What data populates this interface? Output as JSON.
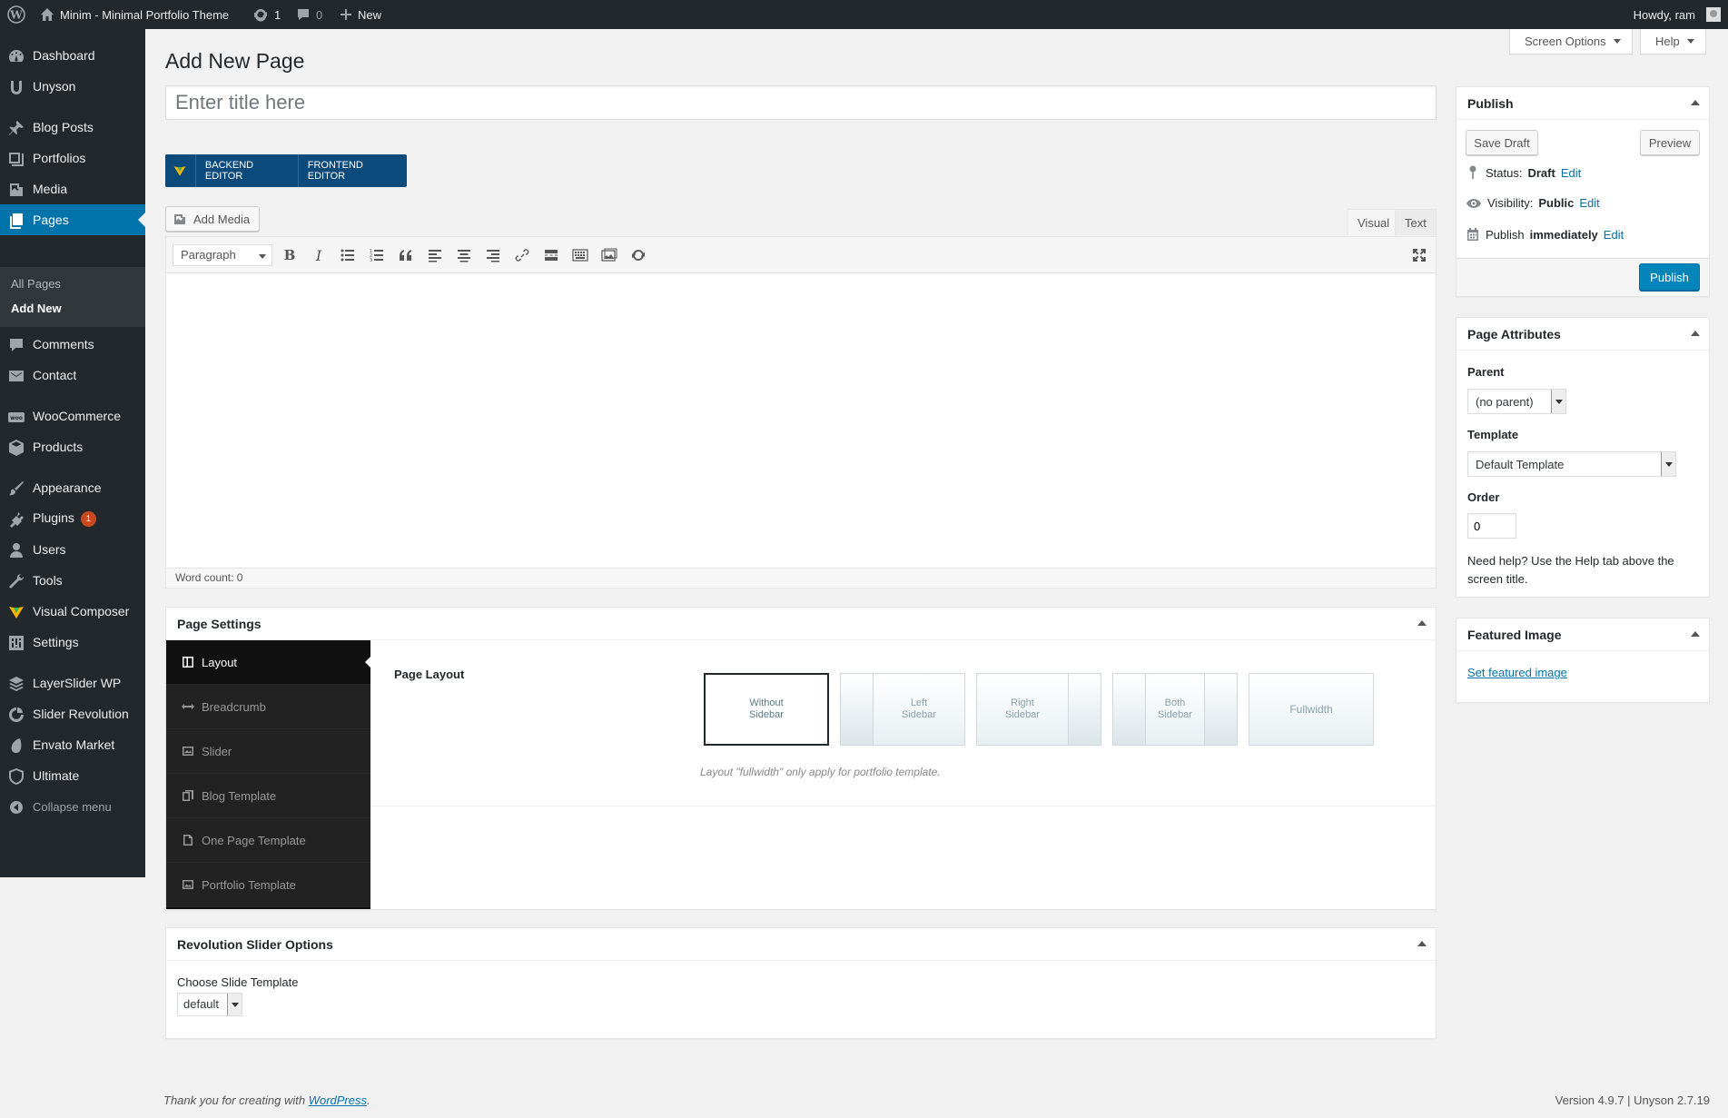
{
  "adminbar": {
    "site_name": "Minim - Minimal Portfolio Theme",
    "updates_count": "1",
    "comments_count": "0",
    "new_label": "New",
    "howdy": "Howdy, ram"
  },
  "sidebar": {
    "items": [
      {
        "label": "Dashboard",
        "icon": "dashboard-icon"
      },
      {
        "label": "Unyson",
        "icon": "unyson-icon"
      },
      {
        "label": "Blog Posts",
        "icon": "pin-icon"
      },
      {
        "label": "Portfolios",
        "icon": "portfolio-icon"
      },
      {
        "label": "Media",
        "icon": "media-icon"
      },
      {
        "label": "Pages",
        "icon": "pages-icon"
      },
      {
        "label": "Comments",
        "icon": "comments-icon"
      },
      {
        "label": "Contact",
        "icon": "mail-icon"
      },
      {
        "label": "WooCommerce",
        "icon": "woocommerce-icon"
      },
      {
        "label": "Products",
        "icon": "products-icon"
      },
      {
        "label": "Appearance",
        "icon": "appearance-icon"
      },
      {
        "label": "Plugins",
        "icon": "plugins-icon",
        "badge": "1"
      },
      {
        "label": "Users",
        "icon": "users-icon"
      },
      {
        "label": "Tools",
        "icon": "tools-icon"
      },
      {
        "label": "Visual Composer",
        "icon": "visual-composer-icon"
      },
      {
        "label": "Settings",
        "icon": "settings-icon"
      },
      {
        "label": "LayerSlider WP",
        "icon": "layerslider-icon"
      },
      {
        "label": "Slider Revolution",
        "icon": "slider-revolution-icon"
      },
      {
        "label": "Envato Market",
        "icon": "envato-icon"
      },
      {
        "label": "Ultimate",
        "icon": "ultimate-icon"
      },
      {
        "label": "Collapse menu",
        "icon": "collapse-icon"
      }
    ],
    "submenu": [
      "All Pages",
      "Add New"
    ]
  },
  "top_tabs": {
    "screen_options": "Screen Options",
    "help": "Help"
  },
  "page": {
    "heading": "Add New Page",
    "title_placeholder": "Enter title here"
  },
  "vc": {
    "backend": "BACKEND EDITOR",
    "frontend": "FRONTEND EDITOR"
  },
  "editor": {
    "add_media": "Add Media",
    "tab_visual": "Visual",
    "tab_text": "Text",
    "format": "Paragraph",
    "word_count": "Word count: 0"
  },
  "publish": {
    "title": "Publish",
    "save_draft": "Save Draft",
    "preview": "Preview",
    "status_label": "Status:",
    "status_value": "Draft",
    "visibility_label": "Visibility:",
    "visibility_value": "Public",
    "publish_label": "Publish",
    "publish_value": "immediately",
    "edit": "Edit",
    "publish_button": "Publish"
  },
  "attributes": {
    "title": "Page Attributes",
    "parent_label": "Parent",
    "parent_value": "(no parent)",
    "template_label": "Template",
    "template_value": "Default Template",
    "order_label": "Order",
    "order_value": "0",
    "help": "Need help? Use the Help tab above the screen title."
  },
  "featured": {
    "title": "Featured Image",
    "link": "Set featured image"
  },
  "page_settings": {
    "title": "Page Settings",
    "tabs": [
      "Layout",
      "Breadcrumb",
      "Slider",
      "Blog Template",
      "One Page Template",
      "Portfolio Template"
    ],
    "layout_label": "Page Layout",
    "options": [
      "Without Sidebar",
      "Left Sidebar",
      "Right Sidebar",
      "Both Sidebar",
      "Fullwidth"
    ],
    "note": "Layout \"fullwidth\" only apply for portfolio template."
  },
  "revslider": {
    "title": "Revolution Slider Options",
    "choose_label": "Choose Slide Template",
    "choose_value": "default"
  },
  "footer": {
    "thanks": "Thank you for creating with",
    "wp_link": "WordPress",
    "version": "Version 4.9.7 | Unyson 2.7.19"
  },
  "colors": {
    "accent": "#0073aa",
    "sidebar_bg": "#23282d",
    "vc_bar": "#0b4a7a",
    "badge": "#ca4a1f"
  }
}
